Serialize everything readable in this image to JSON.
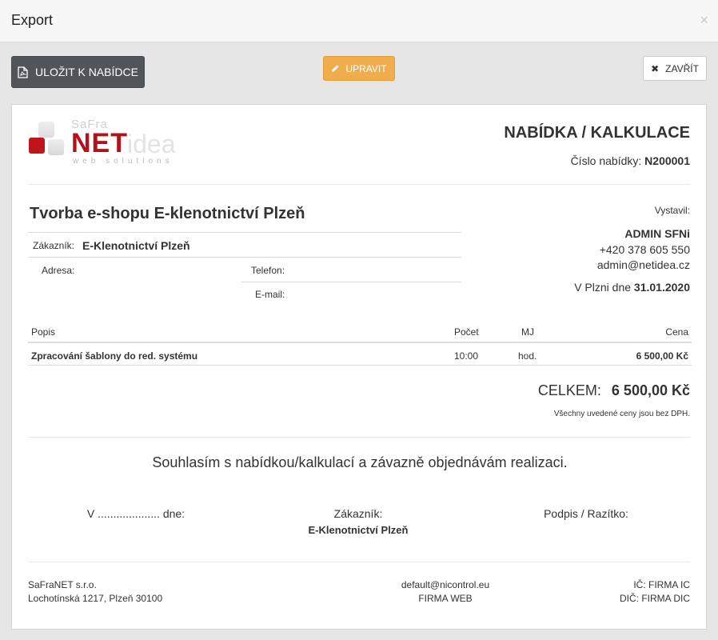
{
  "modal": {
    "title": "Export",
    "close_glyph": "×"
  },
  "toolbar": {
    "save_label": "ULOŽIT K NABÍDCE",
    "edit_label": "UPRAVIT",
    "close_label": "ZAVŘÍT"
  },
  "colors": {
    "danger_red": "#b3121a",
    "warning_orange": "#f0ad4e",
    "dark_button": "#50555a"
  },
  "logo": {
    "safra": "SaFra",
    "net": "NET",
    "idea": "idea",
    "tagline": "web solutions"
  },
  "document": {
    "title": "NABÍDKA / KALKULACE",
    "offer_number_label": "Číslo nabídky:",
    "offer_number": "N200001",
    "project_title": "Tvorba e-shopu E-klenotnictví Plzeň",
    "customer": {
      "label": "Zákazník:",
      "value": "E-Klenotnictví Plzeň",
      "address_label": "Adresa:",
      "phone_label": "Telefon:",
      "email_label": "E-mail:"
    },
    "issuer": {
      "label": "Vystavil:",
      "name": "ADMIN SFNi",
      "phone": "+420 378 605 550",
      "email": "admin@netidea.cz",
      "date_prefix": "V Plzni dne",
      "date": "31.01.2020"
    },
    "items": {
      "headers": {
        "desc": "Popis",
        "qty": "Počet",
        "unit": "MJ",
        "price": "Cena"
      },
      "rows": [
        {
          "desc": "Zpracování šablony do red. systému",
          "qty": "10:00",
          "unit": "hod.",
          "price": "6 500,00 Kč"
        }
      ]
    },
    "total_label": "CELKEM:",
    "total_value": "6 500,00 Kč",
    "vat_note": "Všechny uvedené ceny jsou bez DPH.",
    "agreement": "Souhlasím s nabídkou/kalkulací a závazně objednávám realizaci.",
    "signatures": {
      "place_date": "V .................... dne:",
      "customer_label": "Zákazník:",
      "customer_name": "E-Klenotnictví Plzeň",
      "stamp_label": "Podpis / Razítko:"
    },
    "footer": {
      "company": "SaFraNET s.r.o.",
      "address": "Lochotínská 1217, Plzeň 30100",
      "email": "default@nicontrol.eu",
      "web": "FIRMA WEB",
      "ic": "IČ: FIRMA IC",
      "dic": "DIČ: FIRMA DIC"
    }
  }
}
